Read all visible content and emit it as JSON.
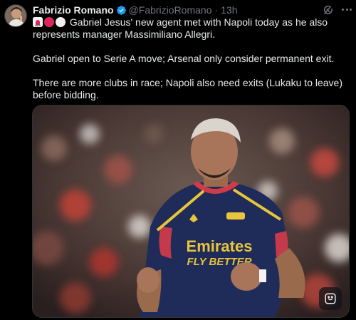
{
  "author": {
    "name": "Fabrizio Romano",
    "handle": "@FabrizioRomano",
    "time": "13h",
    "separator": "·"
  },
  "icons": {
    "verified": "verified-badge-icon",
    "grok": "grok-icon",
    "more": "more-icon",
    "emoji_1": "rotating-light-emoji",
    "emoji_2": "red-circle-emoji",
    "emoji_3": "white-circle-emoji",
    "media_action": "edit-image-icon"
  },
  "tweet": {
    "line1": "Gabriel Jesus' new agent met with Napoli today as he also represents manager Massimiliano Allegri.",
    "line2": "Gabriel open to Serie A move; Arsenal only consider permanent exit.",
    "line3": "There are more clubs in race; Napoli also need exits (Lukaku to leave) before bidding."
  },
  "media": {
    "shirt_text_1": "Emirates",
    "shirt_text_2": "FLY BETTER"
  },
  "colors": {
    "background": "#000000",
    "text": "#e7e9ea",
    "secondary": "#71767b",
    "verified": "#1d9bf0",
    "shirt": "#1f2c5a",
    "shirt_trim": "#e8c53a"
  }
}
